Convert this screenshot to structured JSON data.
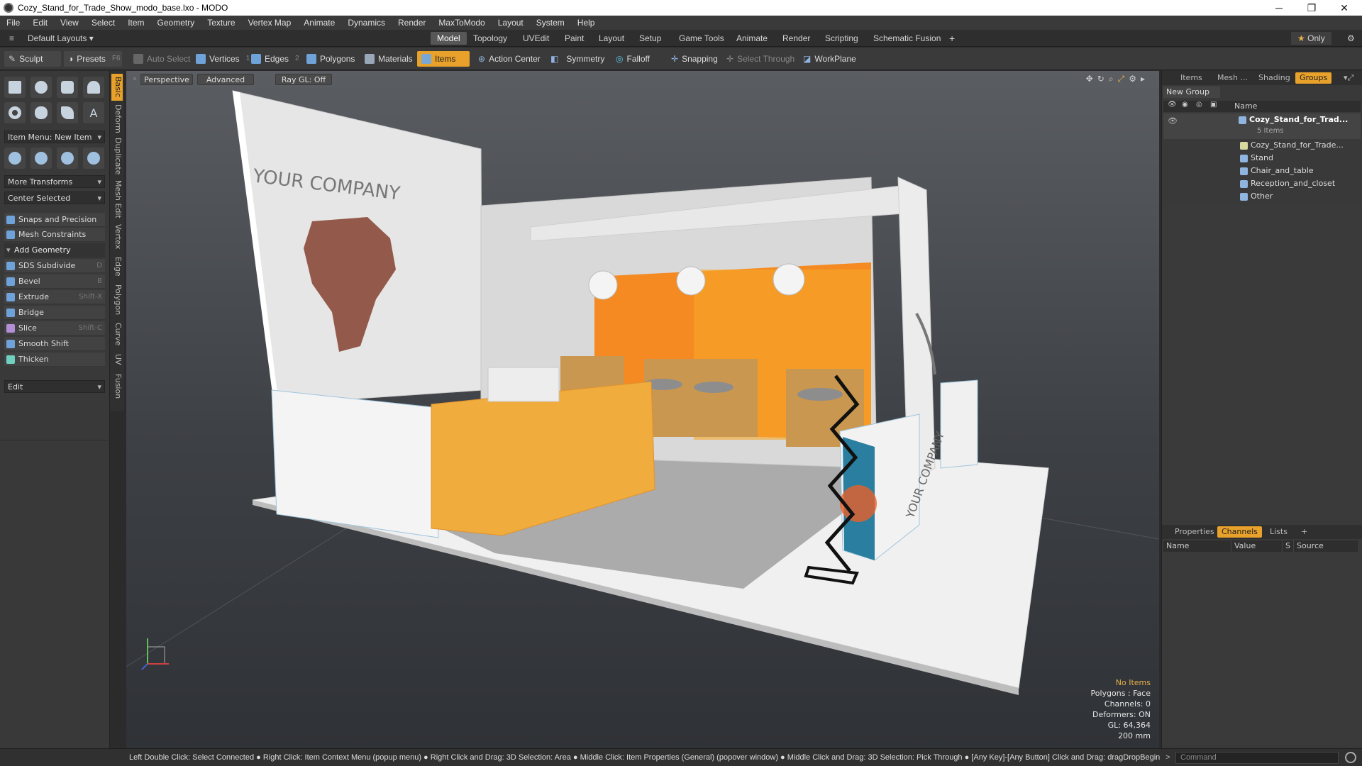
{
  "window": {
    "title": "Cozy_Stand_for_Trade_Show_modo_base.lxo - MODO",
    "controls": [
      "─",
      "❐",
      "✕"
    ]
  },
  "menu": [
    "File",
    "Edit",
    "View",
    "Select",
    "Item",
    "Geometry",
    "Texture",
    "Vertex Map",
    "Animate",
    "Dynamics",
    "Render",
    "MaxToModo",
    "Layout",
    "System",
    "Help"
  ],
  "layoutbar": {
    "layouts_label": "Default Layouts",
    "tabs": [
      "Model",
      "Topology",
      "UVEdit",
      "Paint",
      "Layout",
      "Setup",
      "Game Tools",
      "Animate",
      "Render",
      "Scripting",
      "Schematic Fusion"
    ],
    "active_tab": "Model",
    "add": "+",
    "only_label": "Only"
  },
  "toolbar": {
    "sculpt": "Sculpt",
    "presets": "Presets",
    "presets_hotkey": "F6",
    "auto_select": "Auto Select",
    "vertices": "Vertices",
    "vertices_num": "1",
    "edges": "Edges",
    "edges_num": "2",
    "polygons": "Polygons",
    "materials": "Materials",
    "items": "Items",
    "action_center": "Action Center",
    "symmetry": "Symmetry",
    "falloff": "Falloff",
    "snapping": "Snapping",
    "select_through": "Select Through",
    "workplane": "WorkPlane"
  },
  "leftpanel": {
    "vtabs": [
      "Basic",
      "Deform",
      "Duplicate",
      "Mesh Edit",
      "Vertex",
      "Edge",
      "Polygon",
      "Curve",
      "UV",
      "Fusion"
    ],
    "item_menu": "Item Menu: New Item",
    "more_transforms": "More Transforms",
    "center_selected": "Center Selected",
    "snaps": "Snaps and Precision",
    "mesh_constraints": "Mesh Constraints",
    "add_geometry": "Add Geometry",
    "tools": [
      {
        "label": "SDS Subdivide",
        "hotkey": "D"
      },
      {
        "label": "Bevel",
        "hotkey": "B"
      },
      {
        "label": "Extrude",
        "hotkey": "Shift-X"
      },
      {
        "label": "Bridge",
        "hotkey": ""
      },
      {
        "label": "Slice",
        "hotkey": "Shift-C"
      },
      {
        "label": "Smooth Shift",
        "hotkey": ""
      },
      {
        "label": "Thicken",
        "hotkey": ""
      }
    ],
    "edit": "Edit"
  },
  "viewport": {
    "perspective": "Perspective",
    "advanced": "Advanced",
    "raygl": "Ray GL: Off",
    "wall_text": "YOUR COMPANY",
    "counter_text": "YOUR COMPANY",
    "info": {
      "no_items": "No Items",
      "polygons": "Polygons : Face",
      "channels": "Channels: 0",
      "deformers": "Deformers: ON",
      "gl": "GL: 64,364",
      "scale": "200 mm"
    }
  },
  "rightpanel": {
    "top_tabs": [
      "Items",
      "Mesh ...",
      "Shading",
      "Groups"
    ],
    "active_top": "Groups",
    "new_group": "New Group",
    "name_header": "Name",
    "root": "Cozy_Stand_for_Trad...",
    "root_count": "5 Items",
    "children": [
      "Cozy_Stand_for_Trade...",
      "Stand",
      "Chair_and_table",
      "Reception_and_closet",
      "Other"
    ],
    "bottom_tabs": [
      "Properties",
      "Channels",
      "Lists"
    ],
    "active_bottom": "Channels",
    "cols": [
      "Name",
      "Value",
      "S",
      "Source"
    ]
  },
  "status": {
    "text": "Left Double Click: Select Connected ● Right Click: Item Context Menu (popup menu) ● Right Click and Drag: 3D Selection: Area ● Middle Click: Item Properties (General) (popover window) ● Middle Click and Drag: 3D Selection: Pick Through ● [Any Key]-[Any Button] Click and Drag: dragDropBegin",
    "command_placeholder": "Command"
  }
}
